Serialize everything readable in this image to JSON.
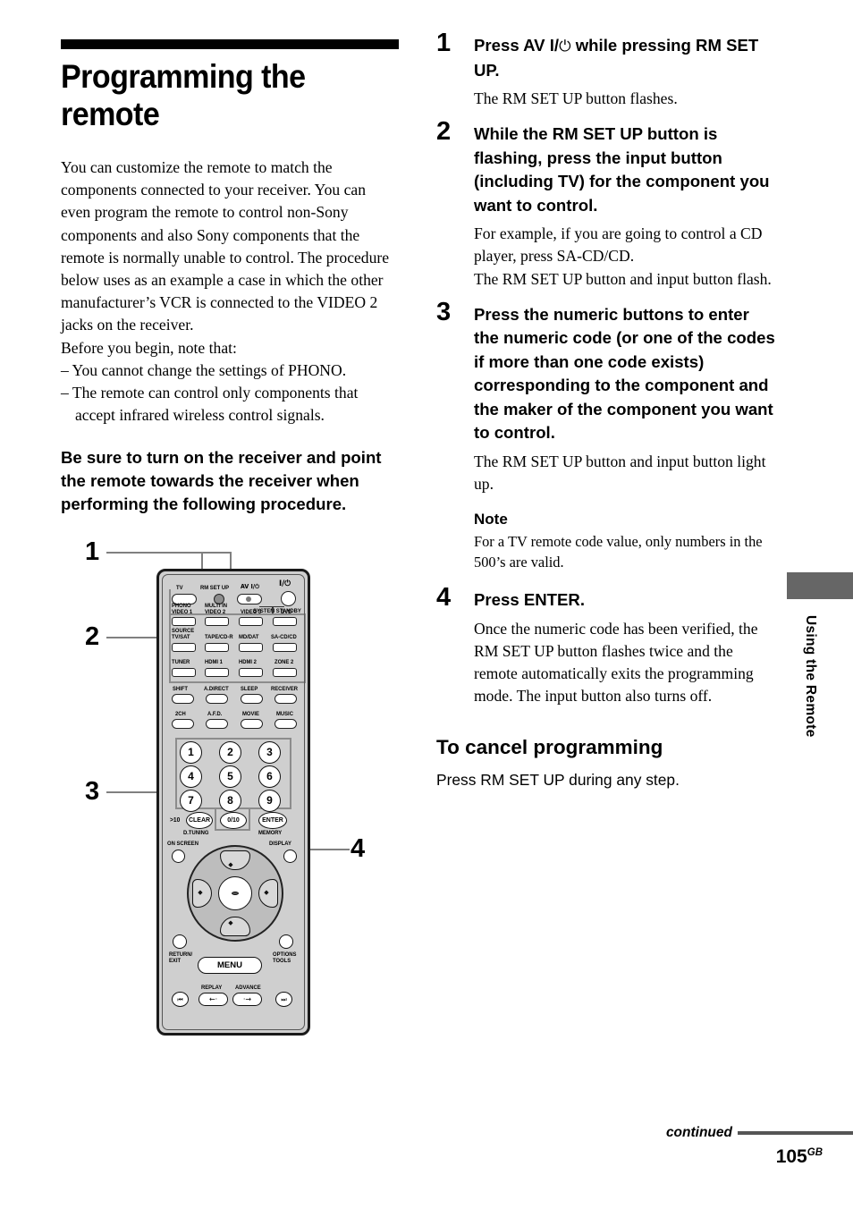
{
  "left_column": {
    "title": "Programming the remote",
    "intro_paragraph": "You can customize the remote to match the components connected to your receiver. You can even program the remote to control non-Sony components and also Sony components that the remote is normally unable to control. The procedure below uses as an example a case in which the other manufacturer’s VCR is connected to the VIDEO 2 jacks on the receiver.",
    "before_line": "Before you begin, note that:",
    "bullets": [
      "– You cannot change the settings of PHONO.",
      "– The remote can control only components that accept infrared wireless control signals."
    ],
    "bold_notice": "Be sure to turn on the receiver and point the remote towards the receiver when performing the following procedure."
  },
  "steps": [
    {
      "number": "1",
      "heading_pre": "Press AV I/",
      "heading_symbol": "⏻",
      "heading_post": " while pressing RM SET UP.",
      "body": "The RM SET UP button flashes."
    },
    {
      "number": "2",
      "heading": "While the RM SET UP button is flashing, press the input button (including TV) for the component you want to control.",
      "body": "For example, if you are going to control a CD player, press SA-CD/CD.\nThe RM SET UP button and input button flash."
    },
    {
      "number": "3",
      "heading": "Press the numeric buttons to enter the numeric code (or one of the codes if more than one code exists) corresponding to the component and the maker of the component you want to control.",
      "body": "The RM SET UP button and input button light up."
    },
    {
      "number": "4",
      "heading": "Press ENTER.",
      "body": "Once the numeric code has been verified, the RM SET UP button flashes twice and the remote automatically exits the programming mode. The input button also turns off."
    }
  ],
  "note": {
    "title": "Note",
    "text": "For a TV remote code value, only numbers in the 500’s are valid."
  },
  "cancel_section": {
    "heading": "To cancel programming",
    "text": "Press RM SET UP during any step."
  },
  "side_tab": {
    "label": "Using the Remote",
    "box_color": "#666666"
  },
  "footer": {
    "continued": "continued",
    "page_number": "105",
    "page_suffix": "GB",
    "rule_color": "#555555"
  },
  "diagram": {
    "callouts": [
      "1",
      "2",
      "3",
      "4"
    ],
    "leader_color": "#808080",
    "body_color": "#cfcfcf",
    "remote_labels": {
      "tv": "TV",
      "rm_set_up": "RM SET UP",
      "av_power": "AV I/⏻",
      "main_power": "I/⏻",
      "system_standby": "SYSTEM STANDBY",
      "source": "SOURCE",
      "row1": [
        "PHONO\nVIDEO 1",
        "MULTI IN\nVIDEO 2",
        "VIDEO 3",
        "DVD"
      ],
      "row2": [
        "TV/SAT",
        "TAPE/CD-R",
        "MD/DAT",
        "SA-CD/CD"
      ],
      "row3": [
        "TUNER",
        "HDMI 1",
        "HDMI 2",
        "ZONE 2"
      ],
      "row4": [
        "SHIFT",
        "A.DIRECT",
        "SLEEP",
        "RECEIVER"
      ],
      "row5": [
        "2CH",
        "A.F.D.",
        "MOVIE",
        "MUSIC"
      ],
      "numbers": [
        "1",
        "2",
        "3",
        "4",
        "5",
        "6",
        "7",
        "8",
        "9"
      ],
      "gt10": ">10",
      "clear": "CLEAR",
      "zero": "0/10",
      "enter": "ENTER",
      "d_tuning": "D.TUNING",
      "memory": "MEMORY",
      "on_screen": "ON SCREEN",
      "display": "DISPLAY",
      "menu": "MENU",
      "return_exit": "RETURN/\nEXIT",
      "options_tools": "OPTIONS\nTOOLS",
      "replay": "REPLAY",
      "advance": "ADVANCE"
    }
  }
}
